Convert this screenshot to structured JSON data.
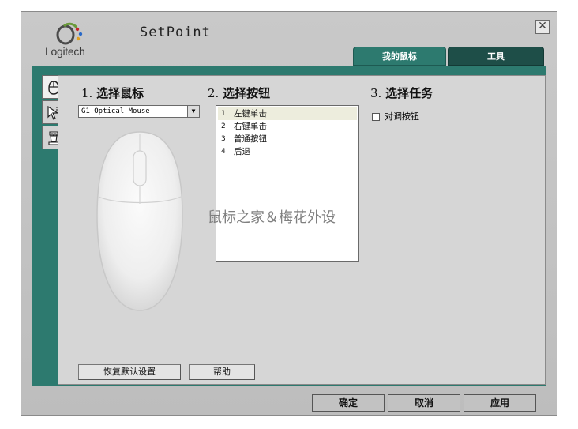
{
  "window": {
    "app_title": "SetPoint",
    "brand": "Logitech",
    "close_glyph": "✕"
  },
  "tabs": [
    {
      "label": "我的鼠标",
      "active": true
    },
    {
      "label": "工具",
      "active": false
    }
  ],
  "side_tabs": [
    {
      "icon": "mouse-icon",
      "active": true
    },
    {
      "icon": "pointer-icon",
      "active": false
    },
    {
      "icon": "game-piece-icon",
      "active": false
    }
  ],
  "step1": {
    "number": "1.",
    "title": "选择鼠标",
    "selected_mouse": "G1 Optical Mouse"
  },
  "step2": {
    "number": "2.",
    "title": "选择按钮",
    "buttons": [
      {
        "num": "1",
        "label": "左键单击"
      },
      {
        "num": "2",
        "label": "右键单击"
      },
      {
        "num": "3",
        "label": "普通按钮"
      },
      {
        "num": "4",
        "label": "后退"
      }
    ]
  },
  "step3": {
    "number": "3.",
    "title": "选择任务",
    "checkbox_label": "对调按钮",
    "checked": false
  },
  "watermark": "鼠标之家＆梅花外设",
  "actions": {
    "restore_defaults": "恢复默认设置",
    "help": "帮助",
    "ok": "确定",
    "cancel": "取消",
    "apply": "应用"
  },
  "colors": {
    "accent_teal": "#2d7a6f",
    "tab_dark": "#1e4e48",
    "window_gray": "#c4c4c4",
    "content_gray": "#d6d6d6"
  }
}
